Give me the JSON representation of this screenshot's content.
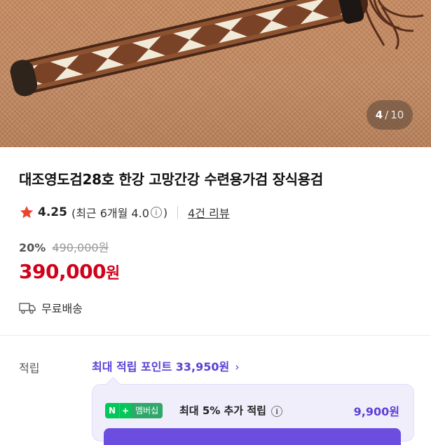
{
  "gallery": {
    "current": "4",
    "separator": "/",
    "total": "10",
    "image_alt": "sword-handle-photo"
  },
  "product": {
    "title": "대조영도검28호 한강 고망간강 수련용가검 장식용검",
    "rating": "4.25",
    "recent_rating": "(최근 6개월 4.0",
    "recent_close": ")",
    "info_icon": "i",
    "reviews_link": "4건 리뷰",
    "discount_rate": "20%",
    "original_price": "490,000원",
    "price_number": "390,000",
    "price_unit": "원",
    "shipping": "무료배송"
  },
  "points": {
    "label": "적립",
    "max_text": "최대 적립 포인트 33,950원",
    "chevron": "›"
  },
  "membership": {
    "badge_n": "N",
    "badge_plus": "+",
    "badge_label": "멤버십",
    "text": "최대 5% 추가 적립",
    "amount": "9,900원"
  },
  "colors": {
    "price_red": "#d0021b",
    "accent_purple": "#5b3fd6",
    "naver_green": "#03c75a",
    "star_red": "#e8452c"
  },
  "icons": [
    "star-icon",
    "info-icon",
    "truck-icon",
    "chevron-right-icon"
  ]
}
